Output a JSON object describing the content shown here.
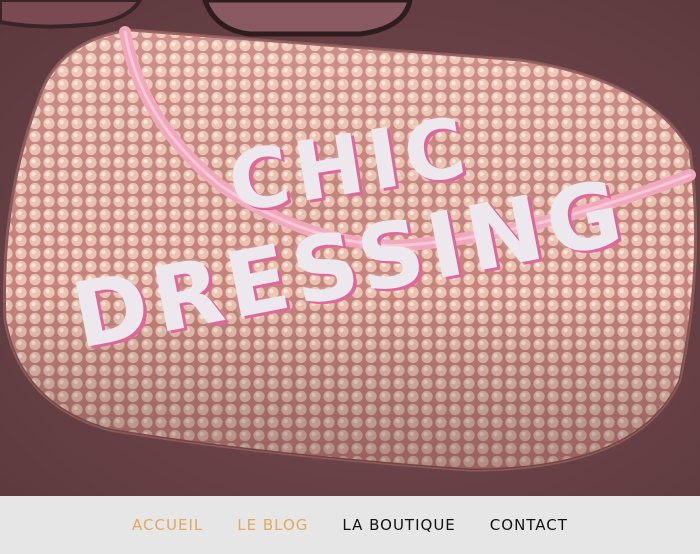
{
  "site": {
    "title_line1": "CHIC",
    "title_line2": "DRESSING"
  },
  "hero_image": {
    "subject": "pink-sequin-clutch-bag",
    "colors": {
      "background": "#6e4a4f",
      "bag": "#e3a79f",
      "sequin_highlight": "#f7d9c4",
      "strap": "#f0a8bd",
      "title_text": "#ece8ee",
      "title_shadow": "#e0679c"
    }
  },
  "nav": {
    "items": [
      {
        "label": "ACCUEIL",
        "color": "#e0a95c"
      },
      {
        "label": "LE BLOG",
        "color": "#e0a95c"
      },
      {
        "label": "LA BOUTIQUE",
        "color": "#111111"
      },
      {
        "label": "CONTACT",
        "color": "#111111"
      }
    ],
    "background": "#e6e6e6"
  }
}
